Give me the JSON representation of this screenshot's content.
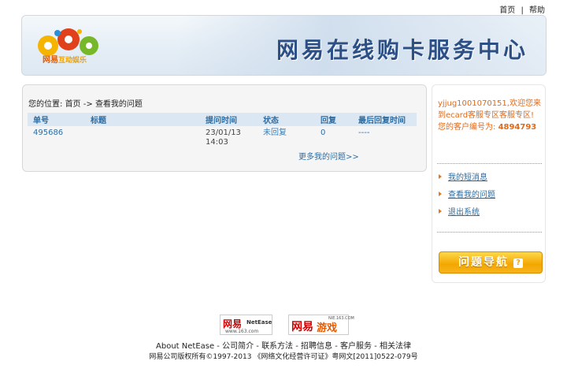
{
  "top_links": [
    "首页",
    "帮助"
  ],
  "top_separator": "|",
  "banner": {
    "logo_cn": "网易",
    "logo_sub": "互动娱乐",
    "title": "网易在线购卡服务中心"
  },
  "breadcrumb": {
    "prefix": "您的位置:",
    "home": "首页",
    "arrow": "->",
    "current": "查看我的问题"
  },
  "table": {
    "headers": [
      "单号",
      "标题",
      "提问时间",
      "状态",
      "回复",
      "最后回复时间"
    ],
    "rows": [
      {
        "id": "495686",
        "title": "",
        "date": "23/01/13",
        "time": "14:03",
        "status": "未回复",
        "replies": "0",
        "last_reply": "----"
      }
    ]
  },
  "more_link": "更多我的问题>>",
  "sidebar": {
    "username": "yjjug1001070151",
    "welcome_text": ",欢迎您来到ecard客服专区客服专区!",
    "customer_label": "您的客户编号为:",
    "customer_number": "4894793",
    "links": [
      "我的短消息",
      "查看我的问题",
      "退出系统"
    ],
    "guide_button": "问题导航",
    "guide_icon_char": "?"
  },
  "footer": {
    "logo1_cn": "网易",
    "logo1_en": "NetEase",
    "logo1_url": "www.163.com",
    "logo2_cn": "网易",
    "logo2_game": "游戏",
    "logo2_url": "NIE.163.COM",
    "links": [
      "About NetEase",
      "公司简介",
      "联系方法",
      "招聘信息",
      "客户服务",
      "相关法律"
    ],
    "link_separator": " - ",
    "copyright": "网易公司版权所有©1997-2013  《网络文化经营许可证》粤网文[2011]0522-079号"
  },
  "colors": {
    "link_blue": "#2e6da4",
    "accent_orange": "#e06a1a",
    "title_blue": "#2c4f86",
    "button_gold": "#f3a600"
  },
  "icons": {
    "logo": "gear-logo-icon",
    "side_arrow": "triangle-right-icon",
    "guide": "question-mark-icon"
  }
}
